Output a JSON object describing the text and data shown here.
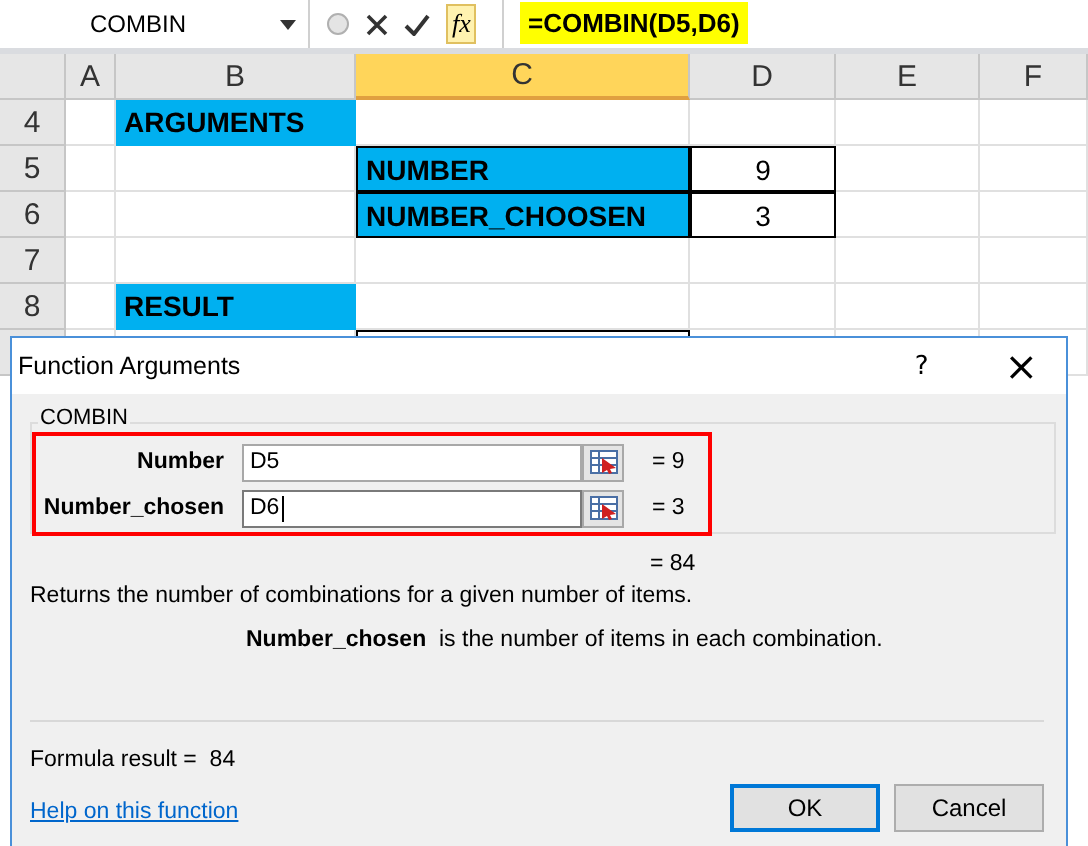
{
  "name_box": {
    "value": "COMBIN"
  },
  "formula_bar": {
    "insert_function_label": "fx",
    "formula": "=COMBIN(D5,D6)",
    "highlighted": true
  },
  "columns": [
    {
      "label": "A",
      "selected": false
    },
    {
      "label": "B",
      "selected": false
    },
    {
      "label": "C",
      "selected": true
    },
    {
      "label": "D",
      "selected": false
    },
    {
      "label": "E",
      "selected": false
    },
    {
      "label": "F",
      "selected": false
    }
  ],
  "rows": [
    {
      "number": "4",
      "cells": [
        {
          "kind": "blank"
        },
        {
          "kind": "heading",
          "text": "ARGUMENTS"
        },
        {
          "kind": "blank"
        },
        {
          "kind": "blank"
        },
        {
          "kind": "blank"
        },
        {
          "kind": "blank"
        }
      ]
    },
    {
      "number": "5",
      "cells": [
        {
          "kind": "blank"
        },
        {
          "kind": "blank"
        },
        {
          "kind": "label",
          "text": "NUMBER"
        },
        {
          "kind": "value",
          "text": "9"
        },
        {
          "kind": "blank"
        },
        {
          "kind": "blank"
        }
      ]
    },
    {
      "number": "6",
      "cells": [
        {
          "kind": "blank"
        },
        {
          "kind": "blank"
        },
        {
          "kind": "label",
          "text": "NUMBER_CHOOSEN"
        },
        {
          "kind": "value",
          "text": "3"
        },
        {
          "kind": "blank"
        },
        {
          "kind": "blank"
        }
      ]
    },
    {
      "number": "7",
      "cells": [
        {
          "kind": "blank"
        },
        {
          "kind": "blank"
        },
        {
          "kind": "blank"
        },
        {
          "kind": "blank"
        },
        {
          "kind": "blank"
        },
        {
          "kind": "blank"
        }
      ]
    },
    {
      "number": "8",
      "cells": [
        {
          "kind": "blank"
        },
        {
          "kind": "heading",
          "text": "RESULT"
        },
        {
          "kind": "blank"
        },
        {
          "kind": "blank"
        },
        {
          "kind": "blank"
        },
        {
          "kind": "blank"
        }
      ]
    },
    {
      "cells": [
        {
          "kind": "blank"
        },
        {
          "kind": "blank"
        },
        {
          "kind": "value"
        },
        {
          "kind": "blank"
        },
        {
          "kind": "blank"
        },
        {
          "kind": "blank"
        }
      ]
    }
  ],
  "dialog": {
    "title": "Function Arguments",
    "help_glyph": "?",
    "close_glyph": "×",
    "function_name": "COMBIN",
    "highlighted": true,
    "arguments": [
      {
        "label": "Number",
        "value": "D5",
        "result": "= 9",
        "focused": false
      },
      {
        "label": "Number_chosen",
        "value": "D6",
        "result": "= 3",
        "focused": true
      }
    ],
    "result": "= 84",
    "description": "Returns the number of combinations for a given number of items.",
    "argument_help": "**Number_chosen**  is the number of items in each combination.",
    "formula_result": "Formula result =  84",
    "help_link": "Help on this function",
    "buttons": [
      {
        "label": "OK",
        "default": true
      },
      {
        "label": "Cancel",
        "default": false
      }
    ]
  }
}
